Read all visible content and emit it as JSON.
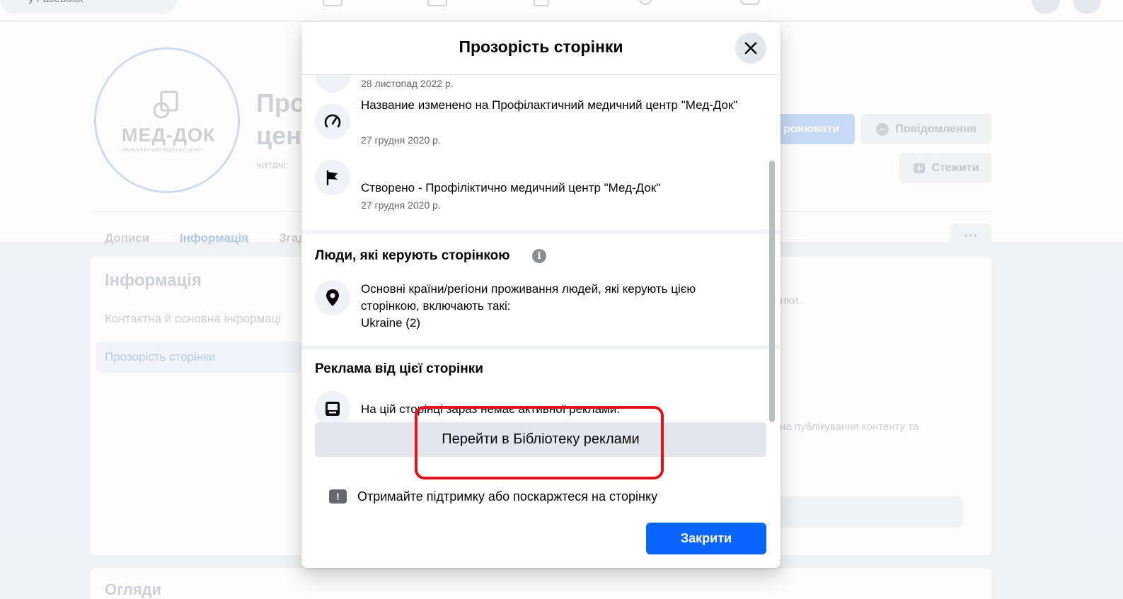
{
  "background": {
    "search_placeholder": "у Facebook",
    "page_name_line1": "Про",
    "page_name_line2": "цен",
    "readers_label": "читачі:",
    "book_button": "ронювати",
    "message_button": "Повідомлення",
    "follow_button": "Стежити",
    "more_button": "···",
    "tabs": [
      {
        "label": "Дописи"
      },
      {
        "label": "Інформація"
      },
      {
        "label": "Згад"
      }
    ],
    "info_card": {
      "title": "Інформація",
      "contact_link": "Контактна й основна інформаці",
      "transparency_link": "Прозорість сторінки",
      "right_text_1": "нки.",
      "right_text_2": "на публікування контенту та"
    },
    "reviews_title": "Огляди",
    "logo_text": "МЕД-ДОК",
    "logo_subtext": "ПРОФІЛАКТИЧНИЙ МЕДИЧНИЙ ЦЕНТР"
  },
  "modal": {
    "title": "Прозорість сторінки",
    "history": [
      {
        "text": "",
        "date": "28 листопад 2022 р.",
        "icon": "history-icon"
      },
      {
        "text": "Название изменено на Профілактичний медичний центр \"Мед-Док\"",
        "date": "27 грудня 2020 р.",
        "icon": "rename-icon"
      },
      {
        "text": "Створено - Профіліктично медичний центр \"Мед-Док\"",
        "date": "27 грудня 2020 р.",
        "icon": "flag-icon"
      }
    ],
    "people_section": {
      "title": "Люди, які керують сторінкою",
      "location_text_line1": "Основні країни/регіони проживання людей, які керують цією",
      "location_text_line2": "сторінкою, включають такі:",
      "location_value": "Ukraine (2)"
    },
    "ads_section": {
      "title": "Реклама від цієї сторінки",
      "no_ads_text": "На цій сторінці зараз немає активної реклами.",
      "library_button": "Перейти в Бібліотеку реклами"
    },
    "report_link": "Отримайте підтримку або поскаржтеся на сторінку",
    "close_button": "Закрити"
  },
  "colors": {
    "primary_blue": "#0866ff",
    "highlight_red": "#e3111b"
  }
}
